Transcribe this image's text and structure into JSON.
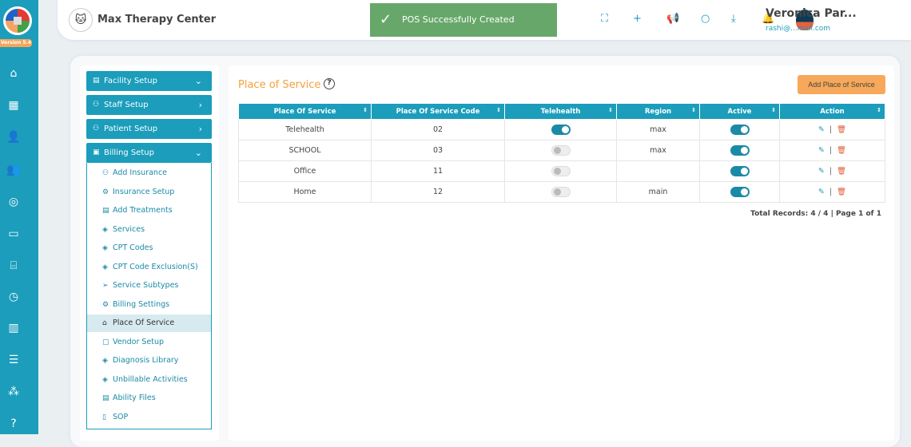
{
  "app": {
    "version": "Version 5.4",
    "brand": "Max Therapy Center"
  },
  "toast": "POS Successfully Created",
  "user": {
    "name": "Veronica Par...",
    "email": "rashi@...mail.com"
  },
  "menu": {
    "sections": [
      "Facility Setup",
      "Staff Setup",
      "Patient Setup",
      "Billing Setup"
    ],
    "billing_items": [
      "Add Insurance",
      "Insurance Setup",
      "Add Treatments",
      "Services",
      "CPT Codes",
      "CPT Code Exclusion(S)",
      "Service Subtypes",
      "Billing Settings",
      "Place Of Service",
      "Vendor Setup",
      "Diagnosis Library",
      "Unbillable Activities",
      "Ability Files",
      "SOP"
    ]
  },
  "page": {
    "title": "Place of Service",
    "add_label": "Add Place of Service",
    "total": "Total Records: 4 / 4 | Page 1 of 1"
  },
  "table": {
    "columns": [
      "Place Of Service",
      "Place Of Service Code",
      "Telehealth",
      "Region",
      "Active",
      "Action"
    ],
    "rows": [
      {
        "name": "Telehealth",
        "code": "02",
        "telehealth": true,
        "region": "max",
        "active": true
      },
      {
        "name": "SCHOOL",
        "code": "03",
        "telehealth": false,
        "region": "max",
        "active": true
      },
      {
        "name": "Office",
        "code": "11",
        "telehealth": false,
        "region": "",
        "active": true
      },
      {
        "name": "Home",
        "code": "12",
        "telehealth": false,
        "region": "main",
        "active": true
      }
    ]
  }
}
